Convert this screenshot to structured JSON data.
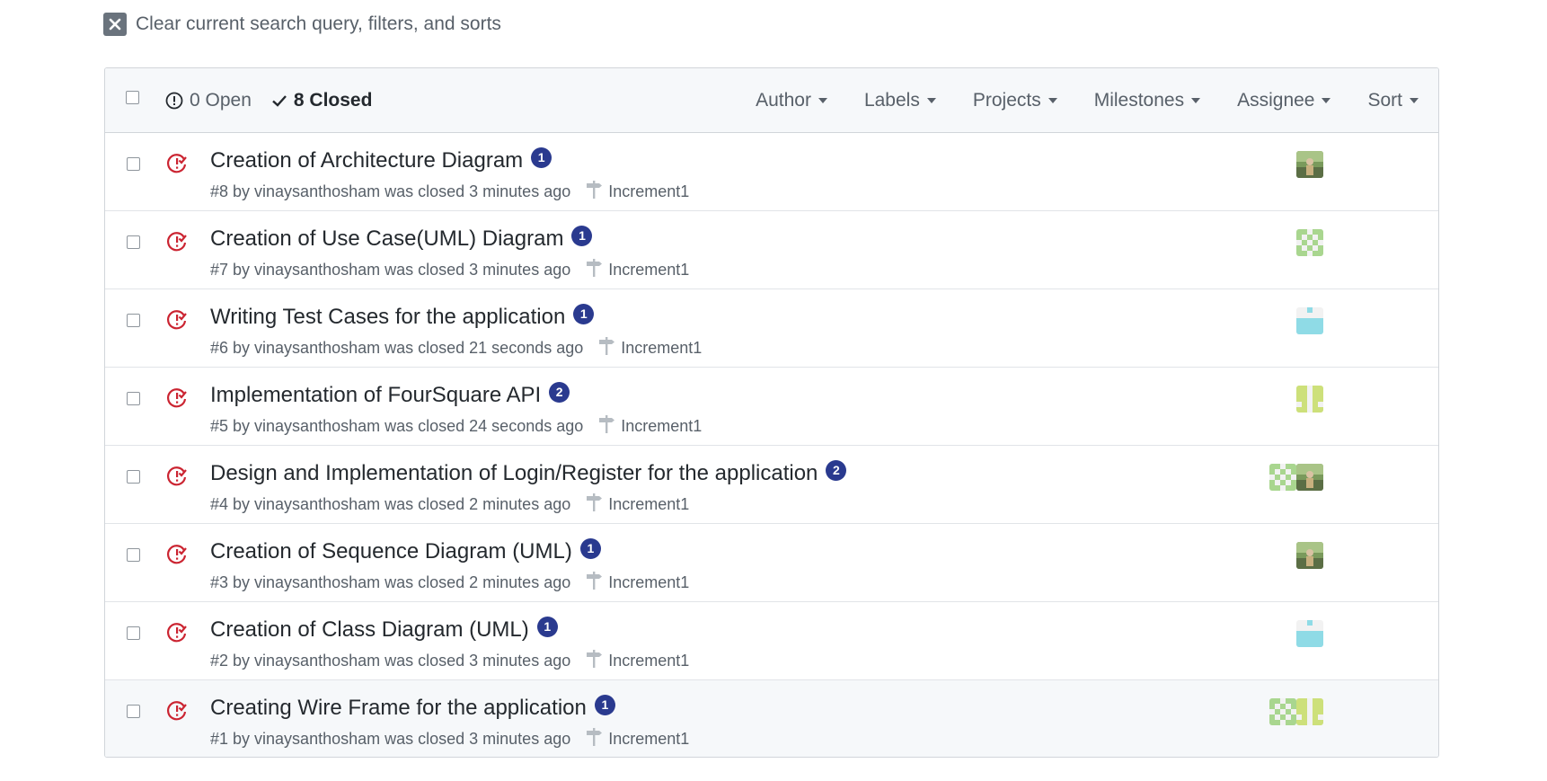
{
  "clear_search": {
    "label": "Clear current search query, filters, and sorts",
    "icon": "x-icon"
  },
  "header": {
    "open_label": "0 Open",
    "closed_label": "8 Closed",
    "filters": [
      "Author",
      "Labels",
      "Projects",
      "Milestones",
      "Assignee",
      "Sort"
    ]
  },
  "colors": {
    "closed_icon": "#cb2431",
    "badge": "#2a3a8f",
    "header_bg": "#f6f8fa"
  },
  "issues": [
    {
      "title": "Creation of Architecture Diagram",
      "comments": "1",
      "meta": "#8 by vinaysanthosham was closed 3 minutes ago",
      "milestone": "Increment1",
      "assignees": [
        "photo"
      ]
    },
    {
      "title": "Creation of Use Case(UML) Diagram",
      "comments": "1",
      "meta": "#7 by vinaysanthosham was closed 3 minutes ago",
      "milestone": "Increment1",
      "assignees": [
        "identicon-green"
      ]
    },
    {
      "title": "Writing Test Cases for the application",
      "comments": "1",
      "meta": "#6 by vinaysanthosham was closed 21 seconds ago",
      "milestone": "Increment1",
      "assignees": [
        "identicon-cyan"
      ]
    },
    {
      "title": "Implementation of FourSquare API",
      "comments": "2",
      "meta": "#5 by vinaysanthosham was closed 24 seconds ago",
      "milestone": "Increment1",
      "assignees": [
        "identicon-lime"
      ]
    },
    {
      "title": "Design and Implementation of Login/Register for the application",
      "comments": "2",
      "meta": "#4 by vinaysanthosham was closed 2 minutes ago",
      "milestone": "Increment1",
      "assignees": [
        "identicon-green",
        "photo"
      ]
    },
    {
      "title": "Creation of Sequence Diagram (UML)",
      "comments": "1",
      "meta": "#3 by vinaysanthosham was closed 2 minutes ago",
      "milestone": "Increment1",
      "assignees": [
        "photo"
      ]
    },
    {
      "title": "Creation of Class Diagram (UML)",
      "comments": "1",
      "meta": "#2 by vinaysanthosham was closed 3 minutes ago",
      "milestone": "Increment1",
      "assignees": [
        "identicon-cyan"
      ]
    },
    {
      "title": "Creating Wire Frame for the application",
      "comments": "1",
      "meta": "#1 by vinaysanthosham was closed 3 minutes ago",
      "milestone": "Increment1",
      "assignees": [
        "identicon-green",
        "identicon-lime"
      ]
    }
  ]
}
